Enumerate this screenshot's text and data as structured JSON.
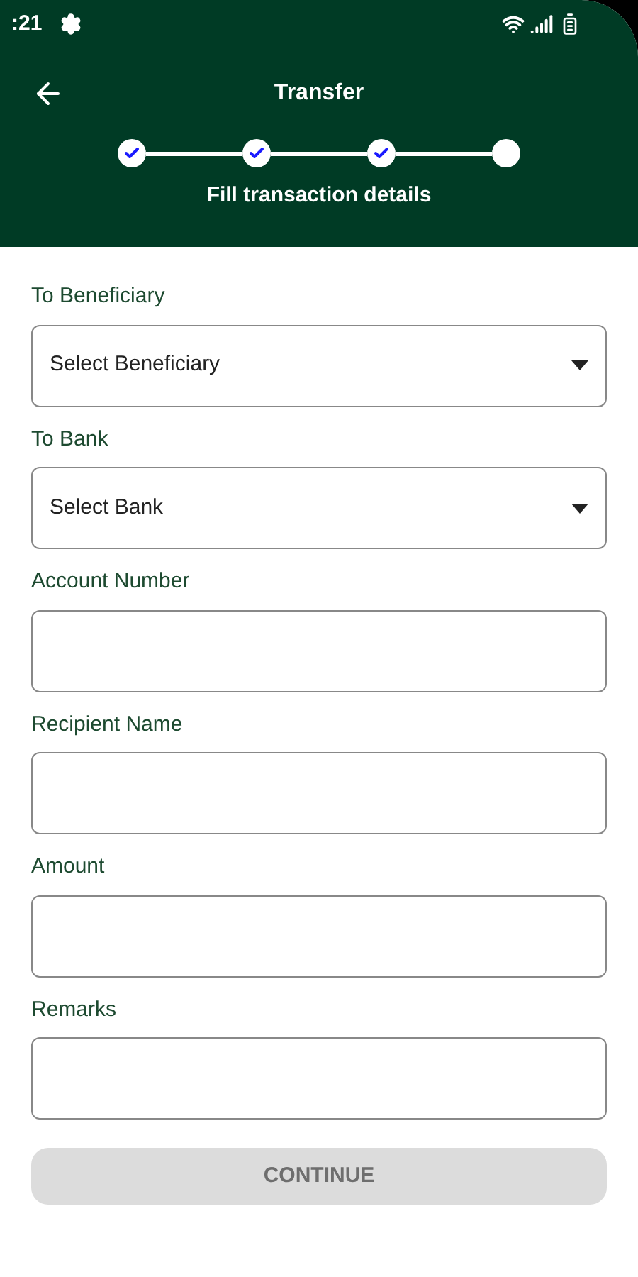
{
  "status_bar": {
    "time": ":21"
  },
  "header": {
    "title": "Transfer",
    "subtitle": "Fill transaction details"
  },
  "steps": [
    {
      "done": true
    },
    {
      "done": true
    },
    {
      "done": true
    },
    {
      "done": false
    }
  ],
  "fields": [
    {
      "kind": "dropdown",
      "label": "To Beneficiary",
      "value": "Select Beneficiary"
    },
    {
      "kind": "dropdown",
      "label": "To Bank",
      "value": "Select Bank"
    },
    {
      "kind": "text",
      "label": "Account Number"
    },
    {
      "kind": "text",
      "label": "Recipient Name"
    },
    {
      "kind": "text",
      "label": "Amount"
    },
    {
      "kind": "text",
      "label": "Remarks"
    }
  ],
  "continue_button": {
    "label": "CONTINUE",
    "disabled": true
  }
}
